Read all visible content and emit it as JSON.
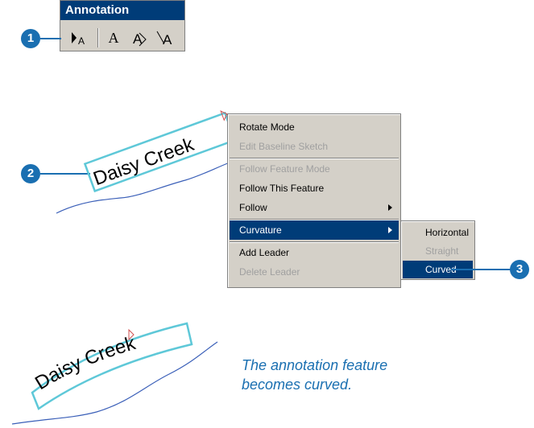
{
  "toolbar": {
    "title": "Annotation",
    "tools": [
      {
        "name": "select-annotation-tool",
        "glyph": "▶A"
      },
      {
        "name": "horizontal-text-tool",
        "glyph": "A"
      },
      {
        "name": "straight-text-tool",
        "glyph": "A"
      },
      {
        "name": "curved-text-tool",
        "glyph": "A"
      }
    ]
  },
  "callouts": [
    "1",
    "2",
    "3"
  ],
  "annotation_text": "Daisy Creek",
  "context_menu": {
    "items": [
      {
        "label": "Rotate Mode",
        "state": "enabled"
      },
      {
        "label": "Edit Baseline Sketch",
        "state": "disabled"
      },
      {
        "label": "Follow Feature Mode",
        "state": "disabled"
      },
      {
        "label": "Follow This Feature",
        "state": "enabled"
      },
      {
        "label": "Follow",
        "state": "enabled"
      },
      {
        "label": "Curvature",
        "state": "selected"
      },
      {
        "label": "Add Leader",
        "state": "enabled"
      },
      {
        "label": "Delete Leader",
        "state": "disabled"
      }
    ]
  },
  "submenu": {
    "items": [
      {
        "label": "Horizontal",
        "state": "enabled"
      },
      {
        "label": "Straight",
        "state": "disabled"
      },
      {
        "label": "Curved",
        "state": "selected"
      }
    ]
  },
  "caption": {
    "line1": "The annotation feature",
    "line2": "becomes curved."
  },
  "colors": {
    "callout": "#1a6fb1",
    "menu_highlight": "#003c78",
    "annotation_box": "#5ec8d8",
    "river": "#3a5fb8"
  }
}
